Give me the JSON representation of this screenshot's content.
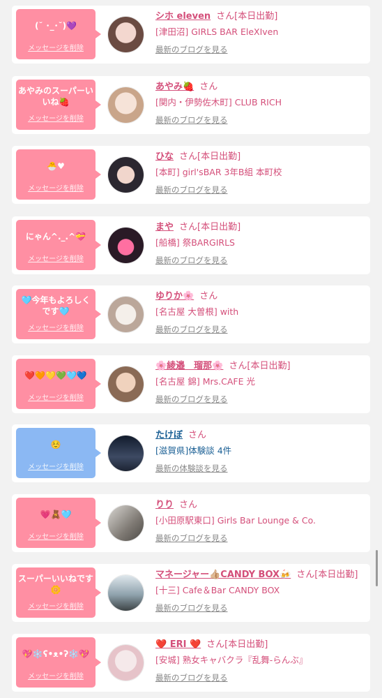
{
  "colors": {
    "pink_bubble": "#ff8fa3",
    "blue_bubble": "#8bb8f3",
    "pink_text": "#d44f7a",
    "blue_text": "#1a5f94"
  },
  "rows": [
    {
      "message": "(˘ ･_･˘)💜",
      "delete_label": "メッセージを削除",
      "name": "シホ eleven",
      "san": "さん[本日出勤]",
      "shop": "[津田沼] GIRLS BAR EleXIven",
      "link": "最新のブログを見る",
      "bubble_color": "#ff8fa3",
      "text_color": "#d44f7a",
      "avatar_icon": "avatar-photo"
    },
    {
      "message": "あやみのスーパーいいね🍓",
      "delete_label": "メッセージを削除",
      "name": "あやみ🍓",
      "san": "さん",
      "shop": "[関内・伊勢佐木町] CLUB RICH",
      "link": "最新のブログを見る",
      "bubble_color": "#ff8fa3",
      "text_color": "#d44f7a",
      "avatar_icon": "avatar-photo"
    },
    {
      "message": "🐣♥",
      "delete_label": "メッセージを削除",
      "name": "ひな",
      "san": "さん[本日出勤]",
      "shop": "[本町] girl'sBAR 3年B組 本町校",
      "link": "最新のブログを見る",
      "bubble_color": "#ff8fa3",
      "text_color": "#d44f7a",
      "avatar_icon": "avatar-photo"
    },
    {
      "message": "にゃん^._.^💝",
      "delete_label": "メッセージを削除",
      "name": "まや",
      "san": "さん[本日出勤]",
      "shop": "[船橋] 祭BARGIRLS",
      "link": "最新のブログを見る",
      "bubble_color": "#ff8fa3",
      "text_color": "#d44f7a",
      "avatar_icon": "avatar-photo"
    },
    {
      "message": "🩵今年もよろしくです🩵",
      "delete_label": "メッセージを削除",
      "name": "ゆりか🌸",
      "san": "さん",
      "shop": "[名古屋 大曽根] with",
      "link": "最新のブログを見る",
      "bubble_color": "#ff8fa3",
      "text_color": "#d44f7a",
      "avatar_icon": "avatar-photo"
    },
    {
      "message": "❤️🧡💛💚🩵💙",
      "delete_label": "メッセージを削除",
      "name": "🌸綾邉　瑠那🌸",
      "san": "さん[本日出勤]",
      "shop": "[名古屋 錦] Mrs.CAFE 光",
      "link": "最新のブログを見る",
      "bubble_color": "#ff8fa3",
      "text_color": "#d44f7a",
      "avatar_icon": "avatar-photo"
    },
    {
      "message": "☺️",
      "delete_label": "メッセージを削除",
      "name": "たけぼ",
      "san": "さん",
      "shop": "[滋賀県]体験談 4件",
      "link": "最新の体験談を見る",
      "bubble_color": "#8bb8f3",
      "text_color": "#1a5f94",
      "avatar_icon": "avatar-photo"
    },
    {
      "message": "💗🧸🩵",
      "delete_label": "メッセージを削除",
      "name": "りり",
      "san": "さん",
      "shop": "[小田原駅東口] Girls Bar Lounge & Co.",
      "link": "最新のブログを見る",
      "bubble_color": "#ff8fa3",
      "text_color": "#d44f7a",
      "avatar_icon": "avatar-photo"
    },
    {
      "message": "スーパーいいねです🌼",
      "delete_label": "メッセージを削除",
      "name": "マネージャー👍🏼CANDY BOX🍻",
      "san": "さん[本日出勤]",
      "shop": "[十三] Cafe＆Bar CANDY BOX",
      "link": "最新のブログを見る",
      "bubble_color": "#ff8fa3",
      "text_color": "#d44f7a",
      "avatar_icon": "avatar-photo"
    },
    {
      "message": "💖❄️ʕ•ᴥ•ʔ❄️💖",
      "delete_label": "メッセージを削除",
      "name": "❤️ ERI ❤️",
      "san": "さん[本日出勤]",
      "shop": "[安城] 熟女キャバクラ『乱舞-らんぶ』",
      "link": "最新のブログを見る",
      "bubble_color": "#ff8fa3",
      "text_color": "#d44f7a",
      "avatar_icon": "avatar-photo"
    }
  ]
}
